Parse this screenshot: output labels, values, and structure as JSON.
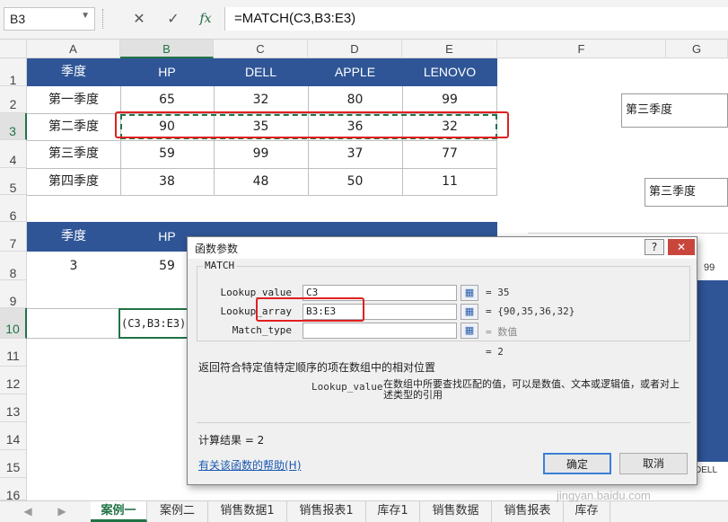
{
  "formula_bar": {
    "name_box": "B3",
    "cancel_icon": "✕",
    "enter_icon": "✓",
    "fx_icon": "fx",
    "formula": "=MATCH(C3,B3:E3)"
  },
  "columns": [
    "A",
    "B",
    "C",
    "D",
    "E",
    "F",
    "G"
  ],
  "rows": [
    "1",
    "2",
    "3",
    "4",
    "5",
    "6",
    "7",
    "8",
    "9",
    "10",
    "11",
    "12",
    "13",
    "14",
    "15",
    "16"
  ],
  "table1": {
    "headers": [
      "季度",
      "HP",
      "DELL",
      "APPLE",
      "LENOVO"
    ],
    "rows": [
      [
        "第一季度",
        "65",
        "32",
        "80",
        "99"
      ],
      [
        "第二季度",
        "90",
        "35",
        "36",
        "32"
      ],
      [
        "第三季度",
        "59",
        "99",
        "37",
        "77"
      ],
      [
        "第四季度",
        "38",
        "48",
        "50",
        "11"
      ]
    ]
  },
  "table2": {
    "headers": [
      "季度",
      "HP"
    ],
    "values": [
      "3",
      "59"
    ],
    "editing_cell": "(C3,B3:E3)"
  },
  "side": {
    "box1": "第三季度",
    "box2": "第三季度",
    "val99": "99",
    "dell": "DELL"
  },
  "dialog": {
    "title": "函数参数",
    "help": "?",
    "close": "✕",
    "function_name": "MATCH",
    "args": [
      {
        "label": "Lookup_value",
        "input": "C3",
        "result": "= 35"
      },
      {
        "label": "Lookup_array",
        "input": "B3:E3",
        "result": "= {90,35,36,32}"
      },
      {
        "label": "Match_type",
        "input": "",
        "result": "= 数值"
      }
    ],
    "formula_result_line": "= 2",
    "description": "返回符合特定值特定顺序的项在数组中的相对位置",
    "arg_help_label": "Lookup_value",
    "arg_help_text": "在数组中所要查找匹配的值，可以是数值、文本或逻辑值，或者对上述类型的引用",
    "calc_result": "计算结果 = 2",
    "help_link": "有关该函数的帮助(H)",
    "ok": "确定",
    "cancel": "取消"
  },
  "sheet_tabs": [
    "案例一",
    "案例二",
    "销售数据1",
    "销售报表1",
    "库存1",
    "销售数据",
    "销售报表",
    "库存"
  ],
  "active_tab": "案例一",
  "watermark": "jingyan.baidu.com"
}
